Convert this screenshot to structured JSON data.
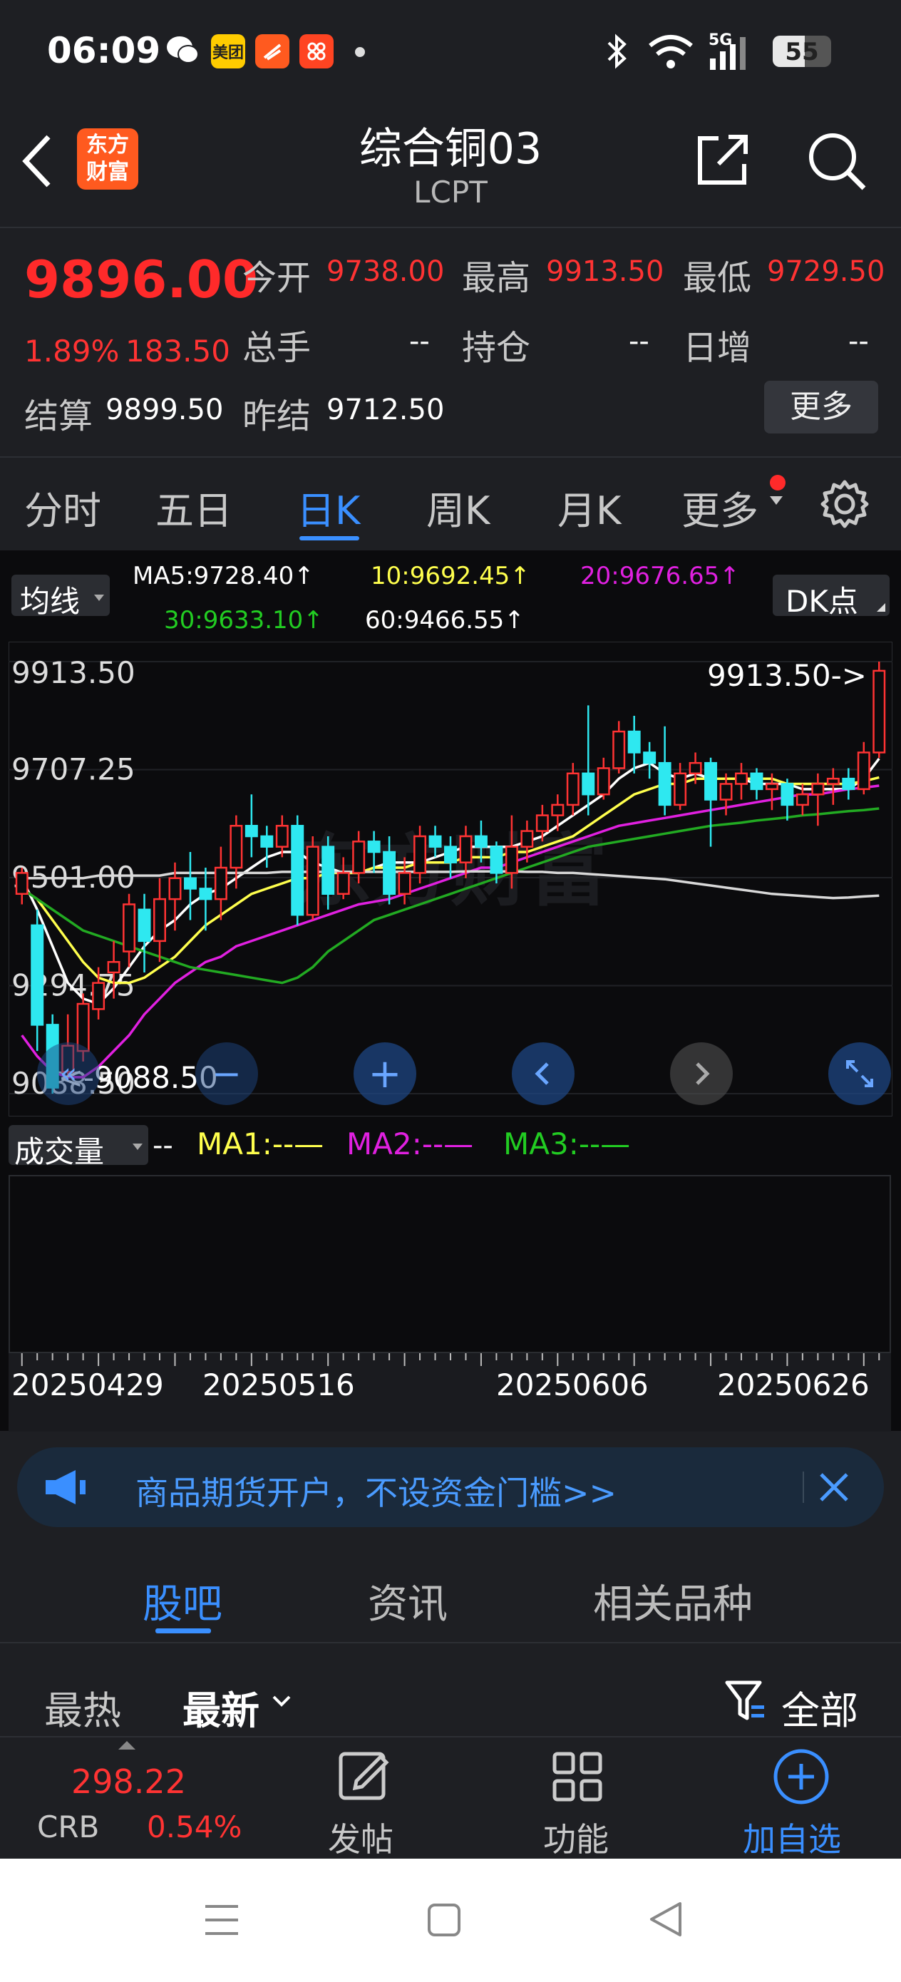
{
  "status": {
    "time": "06:09",
    "network": "5G",
    "battery": "55",
    "app1": "美团"
  },
  "header": {
    "title": "综合铜03",
    "code": "LCPT",
    "logo_line1": "东方",
    "logo_line2": "财富"
  },
  "quote": {
    "price": "9896.00",
    "change_pct": "1.89%",
    "change": "183.50",
    "open_label": "今开",
    "open": "9738.00",
    "high_label": "最高",
    "high": "9913.50",
    "low_label": "最低",
    "low": "9729.50",
    "volume_label": "总手",
    "volume": "--",
    "oi_label": "持仓",
    "oi": "--",
    "daily_inc_label": "日增",
    "daily_inc": "--",
    "settle_label": "结算",
    "settle": "9899.50",
    "prev_settle_label": "昨结",
    "prev_settle": "9712.50",
    "more_button": "更多"
  },
  "tabs": [
    "分时",
    "五日",
    "日K",
    "周K",
    "月K",
    "更多"
  ],
  "active_tab": "日K",
  "chart_head": {
    "ma_select": "均线",
    "ma5": "MA5:9728.40↑",
    "ma10": "10:9692.45↑",
    "ma20": "20:9676.65↑",
    "ma30": "30:9633.10↑",
    "ma60": "60:9466.55↑",
    "dk_button": "DK点"
  },
  "chart_data": {
    "type": "candlestick",
    "y_ticks": [
      "9913.50",
      "9707.25",
      "9501.00",
      "9294.75",
      "9088.50"
    ],
    "ylim": [
      9088.5,
      9913.5
    ],
    "high_marker": "9913.50->",
    "low_marker": "<-9088.50",
    "x_ticks": [
      "20250429",
      "20250516",
      "20250606",
      "20250626"
    ],
    "candles": [
      [
        9470,
        9510,
        9450,
        9520
      ],
      [
        9410,
        9220,
        9170,
        9440
      ],
      [
        9220,
        9100,
        9088.5,
        9240
      ],
      [
        9130,
        9180,
        9120,
        9240
      ],
      [
        9170,
        9260,
        9150,
        9280
      ],
      [
        9250,
        9300,
        9230,
        9330
      ],
      [
        9320,
        9340,
        9270,
        9380
      ],
      [
        9360,
        9450,
        9330,
        9470
      ],
      [
        9440,
        9380,
        9320,
        9470
      ],
      [
        9380,
        9460,
        9340,
        9500
      ],
      [
        9460,
        9500,
        9400,
        9530
      ],
      [
        9500,
        9480,
        9420,
        9550
      ],
      [
        9480,
        9460,
        9400,
        9520
      ],
      [
        9460,
        9520,
        9420,
        9560
      ],
      [
        9520,
        9600,
        9480,
        9620
      ],
      [
        9600,
        9580,
        9540,
        9660
      ],
      [
        9580,
        9560,
        9520,
        9600
      ],
      [
        9560,
        9600,
        9540,
        9620
      ],
      [
        9600,
        9430,
        9410,
        9620
      ],
      [
        9430,
        9560,
        9420,
        9580
      ],
      [
        9560,
        9470,
        9440,
        9580
      ],
      [
        9470,
        9510,
        9460,
        9540
      ],
      [
        9510,
        9570,
        9490,
        9590
      ],
      [
        9570,
        9550,
        9510,
        9590
      ],
      [
        9550,
        9470,
        9450,
        9580
      ],
      [
        9470,
        9510,
        9450,
        9540
      ],
      [
        9510,
        9580,
        9490,
        9600
      ],
      [
        9580,
        9560,
        9540,
        9600
      ],
      [
        9560,
        9530,
        9500,
        9580
      ],
      [
        9530,
        9580,
        9500,
        9600
      ],
      [
        9580,
        9560,
        9530,
        9610
      ],
      [
        9560,
        9510,
        9490,
        9570
      ],
      [
        9510,
        9560,
        9480,
        9620
      ],
      [
        9560,
        9590,
        9530,
        9610
      ],
      [
        9590,
        9620,
        9570,
        9640
      ],
      [
        9620,
        9640,
        9590,
        9660
      ],
      [
        9640,
        9700,
        9620,
        9720
      ],
      [
        9700,
        9660,
        9620,
        9830
      ],
      [
        9660,
        9710,
        9650,
        9730
      ],
      [
        9710,
        9780,
        9700,
        9800
      ],
      [
        9780,
        9740,
        9700,
        9810
      ],
      [
        9740,
        9720,
        9690,
        9760
      ],
      [
        9720,
        9640,
        9620,
        9790
      ],
      [
        9640,
        9700,
        9630,
        9720
      ],
      [
        9700,
        9720,
        9680,
        9740
      ],
      [
        9720,
        9650,
        9560,
        9730
      ],
      [
        9650,
        9680,
        9620,
        9700
      ],
      [
        9680,
        9700,
        9650,
        9720
      ],
      [
        9700,
        9670,
        9650,
        9710
      ],
      [
        9670,
        9680,
        9630,
        9700
      ],
      [
        9680,
        9640,
        9610,
        9690
      ],
      [
        9640,
        9660,
        9620,
        9680
      ],
      [
        9660,
        9680,
        9600,
        9700
      ],
      [
        9680,
        9690,
        9640,
        9710
      ],
      [
        9690,
        9670,
        9650,
        9710
      ],
      [
        9670,
        9740,
        9660,
        9760
      ],
      [
        9740,
        9896,
        9729.5,
        9913.5
      ]
    ],
    "ma_lines": [
      {
        "name": "MA5",
        "color": "#ffffff",
        "values": [
          9500,
          9440,
          9370,
          9300,
          9270,
          9260,
          9290,
          9330,
          9370,
          9400,
          9420,
          9450,
          9470,
          9480,
          9500,
          9520,
          9540,
          9550,
          9550,
          9530,
          9520,
          9510,
          9510,
          9520,
          9530,
          9530,
          9530,
          9540,
          9550,
          9560,
          9560,
          9560,
          9560,
          9570,
          9580,
          9600,
          9620,
          9640,
          9660,
          9690,
          9710,
          9720,
          9700,
          9690,
          9700,
          9690,
          9690,
          9690,
          9680,
          9680,
          9680,
          9670,
          9670,
          9670,
          9670,
          9690,
          9728.4
        ]
      },
      {
        "name": "MA10",
        "color": "#ffff4d",
        "values": [
          9480,
          9460,
          9420,
          9380,
          9340,
          9310,
          9300,
          9300,
          9310,
          9330,
          9350,
          9380,
          9410,
          9430,
          9450,
          9470,
          9480,
          9490,
          9500,
          9500,
          9510,
          9510,
          9510,
          9520,
          9520,
          9520,
          9530,
          9530,
          9530,
          9540,
          9540,
          9540,
          9550,
          9550,
          9560,
          9570,
          9580,
          9600,
          9620,
          9640,
          9660,
          9670,
          9680,
          9680,
          9690,
          9690,
          9690,
          9690,
          9690,
          9690,
          9680,
          9680,
          9680,
          9680,
          9680,
          9685,
          9692.45
        ]
      },
      {
        "name": "MA20",
        "color": "#e020e0",
        "values": [
          9200,
          9160,
          9130,
          9120,
          9120,
          9140,
          9170,
          9200,
          9240,
          9270,
          9300,
          9320,
          9340,
          9350,
          9370,
          9380,
          9390,
          9400,
          9410,
          9420,
          9430,
          9440,
          9450,
          9455,
          9460,
          9470,
          9480,
          9490,
          9500,
          9510,
          9520,
          9520,
          9530,
          9540,
          9550,
          9560,
          9570,
          9580,
          9590,
          9600,
          9605,
          9610,
          9615,
          9620,
          9625,
          9630,
          9635,
          9640,
          9645,
          9650,
          9655,
          9660,
          9660,
          9665,
          9670,
          9673,
          9676.65
        ]
      },
      {
        "name": "MA30",
        "color": "#22aa22",
        "values": [
          9480,
          9460,
          9440,
          9420,
          9400,
          9390,
          9380,
          9370,
          9360,
          9350,
          9340,
          9330,
          9325,
          9320,
          9315,
          9310,
          9305,
          9300,
          9310,
          9330,
          9360,
          9380,
          9400,
          9420,
          9430,
          9440,
          9450,
          9460,
          9470,
          9480,
          9490,
          9500,
          9510,
          9520,
          9530,
          9540,
          9550,
          9560,
          9565,
          9570,
          9575,
          9580,
          9585,
          9590,
          9595,
          9600,
          9603,
          9606,
          9610,
          9613,
          9616,
          9620,
          9622,
          9625,
          9628,
          9630,
          9633.1
        ]
      },
      {
        "name": "MA60",
        "color": "#d8d8d8",
        "values": [
          9500,
          9500,
          9500,
          9500,
          9500,
          9505,
          9505,
          9505,
          9505,
          9505,
          9510,
          9510,
          9510,
          9510,
          9510,
          9510,
          9510,
          9512,
          9512,
          9512,
          9512,
          9512,
          9512,
          9512,
          9512,
          9512,
          9512,
          9512,
          9512,
          9513,
          9513,
          9513,
          9513,
          9512,
          9512,
          9510,
          9510,
          9508,
          9506,
          9504,
          9502,
          9500,
          9498,
          9494,
          9490,
          9486,
          9482,
          9478,
          9474,
          9470,
          9468,
          9466,
          9464,
          9462,
          9463,
          9465,
          9466.55
        ]
      }
    ]
  },
  "volume": {
    "label": "成交量",
    "value": "--",
    "ma1": "MA1:--",
    "ma2": "MA2:--",
    "ma3": "MA3:--"
  },
  "ad": {
    "text": "商品期货开户，不设资金门槛>>"
  },
  "section_tabs": [
    "股吧",
    "资讯",
    "相关品种"
  ],
  "sort": {
    "hot": "最热",
    "latest": "最新",
    "filter": "全部"
  },
  "bottom": {
    "index_value": "298.22",
    "index_name": "CRB",
    "index_pct": "0.54%",
    "post": "发帖",
    "function": "功能",
    "add_watch": "加自选"
  },
  "colors": {
    "up": "#ff3333",
    "down": "#2ee8f0",
    "accent": "#3a8fff"
  }
}
